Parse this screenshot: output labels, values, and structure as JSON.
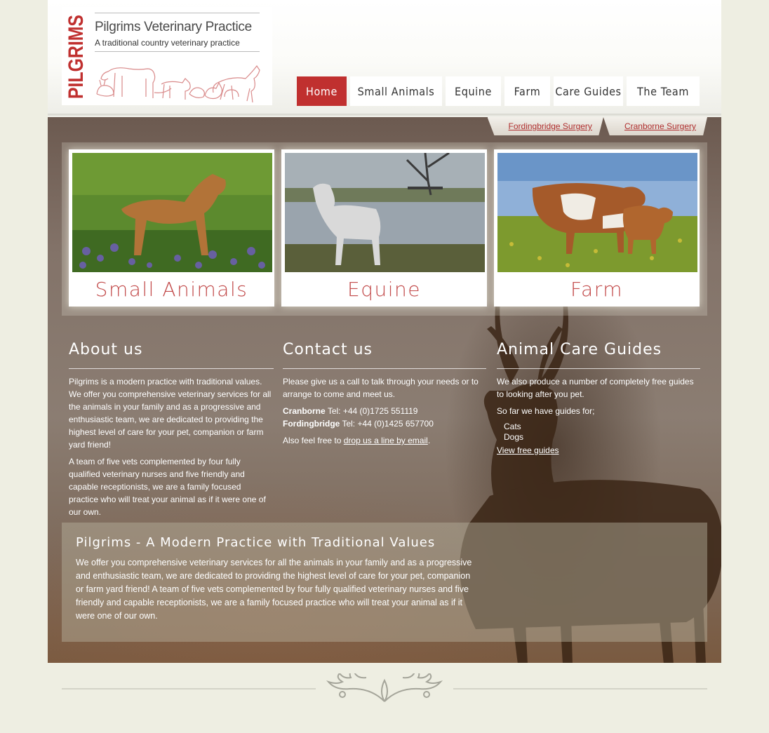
{
  "logo": {
    "vertical": "PILGRIMS",
    "title": "Pilgrims Veterinary Practice",
    "tagline": "A traditional country veterinary practice"
  },
  "nav": [
    "Home",
    "Small Animals",
    "Equine",
    "Farm",
    "Care Guides",
    "The Team"
  ],
  "surgery_tabs": [
    "Fordingbridge Surgery",
    "Cranborne Surgery"
  ],
  "features": [
    {
      "label": "Small Animals"
    },
    {
      "label": "Equine"
    },
    {
      "label": "Farm"
    }
  ],
  "about": {
    "title": "About us",
    "p1": "Pilgrims is a modern practice with traditional values. We offer you comprehensive veterinary services for all the animals in your family and as a progressive and enthusiastic team, we are dedicated to providing the highest level of care for your pet, companion or farm yard friend!",
    "p2": "A team of five vets complemented by four fully qualified veterinary nurses and five friendly and capable receptionists, we are a family focused practice who will treat your animal as if it were one of our own."
  },
  "contact": {
    "title": "Contact us",
    "intro": "Please give us a call to talk through your needs or to arrange to come and meet us.",
    "cranborne_name": "Cranborne",
    "cranborne_tel": "Tel: +44 (0)1725 551119",
    "fordingbridge_name": "Fordingbridge",
    "fordingbridge_tel": "Tel: +44 (0)1425 657700",
    "email_prefix": "Also feel free to",
    "email_link": "drop us a line by email",
    "email_suffix": "."
  },
  "guides": {
    "title": "Animal Care Guides",
    "intro": "We also produce a number of completely free guides to looking after you pet.",
    "so_far": "So far we have guides for;",
    "items": [
      "Cats",
      "Dogs"
    ],
    "link": "View free guides"
  },
  "band": {
    "title": "Pilgrims - A Modern Practice with Traditional Values",
    "text": "We offer you comprehensive veterinary services for all the animals in your family and as a progressive and enthusiastic team, we are dedicated to providing the highest level of care for your pet, companion or farm yard friend! A team of five vets complemented by four fully qualified veterinary nurses and five friendly and capable receptionists, we are a family focused practice who will treat your animal as if it were one of our own."
  },
  "colors": {
    "brand_red": "#c0302f",
    "feature_label": "#c24a4a",
    "background": "#eeeee2"
  }
}
